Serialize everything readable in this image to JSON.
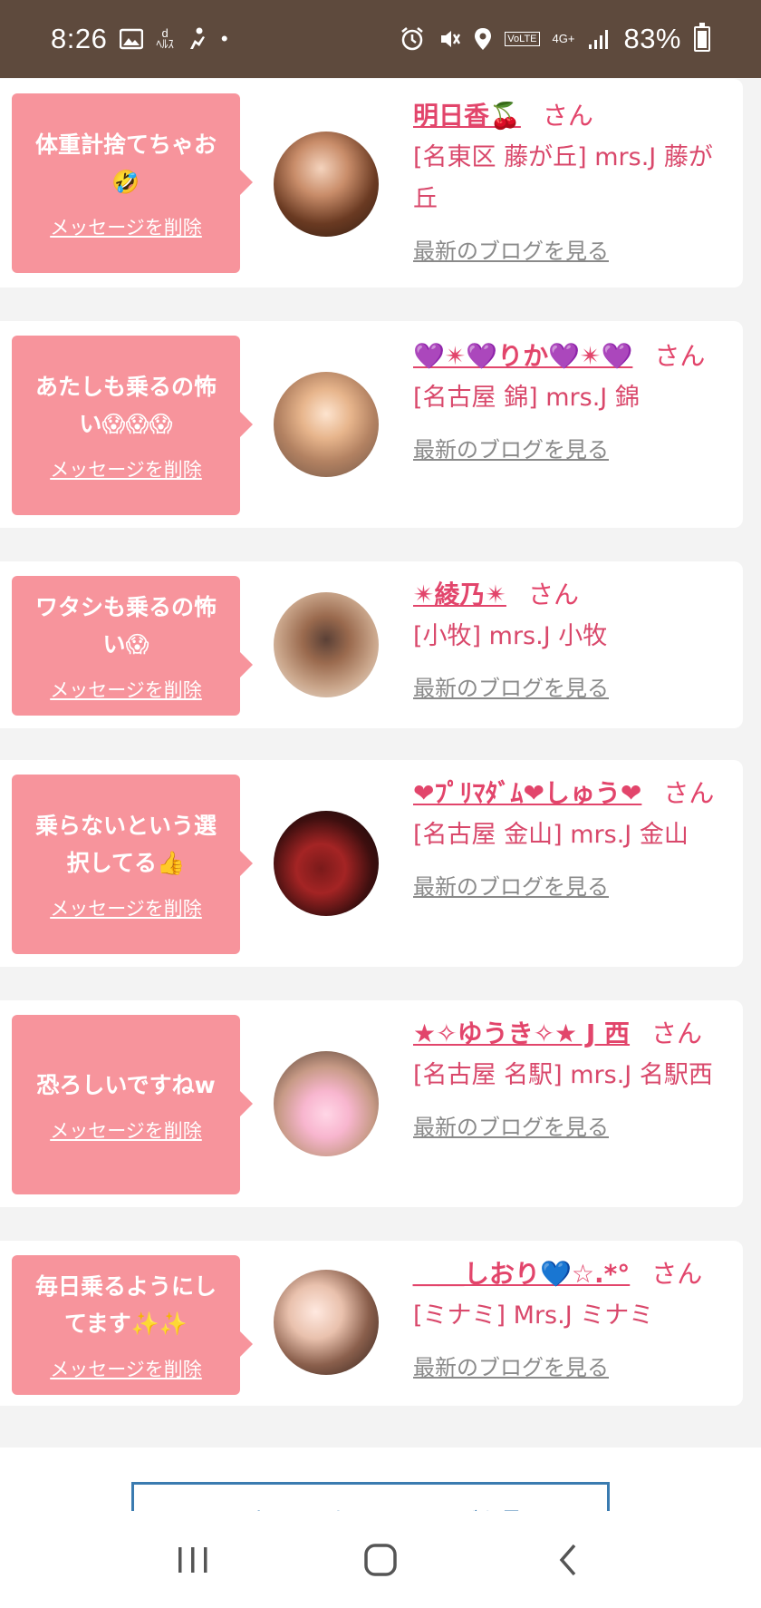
{
  "status_bar": {
    "time": "8:26",
    "battery": "83%",
    "network": "4G+",
    "volte": "VoLTE"
  },
  "entries": [
    {
      "message": "体重計捨てちゃお🤣",
      "delete_label": "メッセージを削除",
      "name": "明日香🍒",
      "honorific": "さん",
      "shop": "[名東区 藤が丘] mrs.J 藤が丘",
      "blog_link": "最新のブログを見る"
    },
    {
      "message": "あたしも乗るの怖い😱😱😱",
      "delete_label": "メッセージを削除",
      "name": "💜✴💜りか💜✴💜",
      "honorific": "さん",
      "shop": "[名古屋 錦] mrs.J 錦",
      "blog_link": "最新のブログを見る"
    },
    {
      "message": "ワタシも乗るの怖い😱",
      "delete_label": "メッセージを削除",
      "name": "✴綾乃✴",
      "honorific": "さん",
      "shop": "[小牧] mrs.J 小牧",
      "blog_link": "最新のブログを見る"
    },
    {
      "message": "乗らないという選択してる👍",
      "delete_label": "メッセージを削除",
      "name": "❤ﾌﾟﾘﾏﾀﾞﾑ❤しゅう❤",
      "honorific": "さん",
      "shop": "[名古屋 金山] mrs.J 金山",
      "blog_link": "最新のブログを見る"
    },
    {
      "message": "恐ろしいですねw",
      "delete_label": "メッセージを削除",
      "name": "★✧ゆうき✧★ J 西",
      "honorific": "さん",
      "shop": "[名古屋 名駅] mrs.J 名駅西",
      "blog_link": "最新のブログを見る"
    },
    {
      "message": "毎日乗るようにしてます✨✨",
      "delete_label": "メッセージを削除",
      "name": "＿＿しおり💙☆.*°",
      "honorific": "さん",
      "shop": "[ミナミ] Mrs.J ミナミ",
      "blog_link": "最新のブログを見る"
    }
  ],
  "ranking_button": "スーパーイイネのランキングを見る",
  "colors": {
    "status_bar_bg": "#5e4a3d",
    "bubble_bg": "#f7949c",
    "name_color": "#e2456b",
    "link_gray": "#8a8a8a",
    "button_blue": "#3a7bb0"
  },
  "icons": {
    "nav": [
      "recent-apps-icon",
      "home-icon",
      "back-icon"
    ]
  }
}
